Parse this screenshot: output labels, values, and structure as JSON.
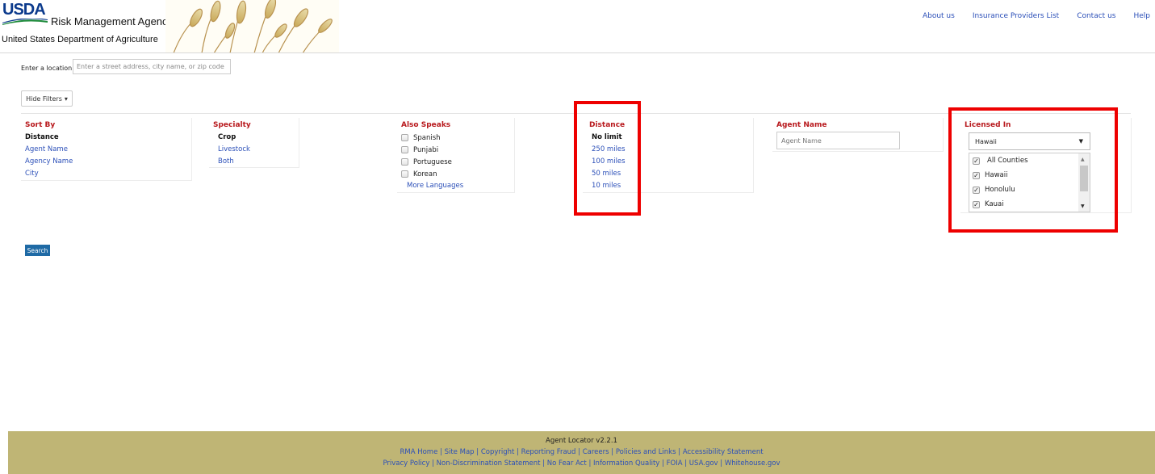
{
  "header": {
    "logo_text": "USDA",
    "agency": "Risk Management Agency",
    "department": "United States Department of Agriculture",
    "nav": [
      "About us",
      "Insurance Providers List",
      "Contact us",
      "Help"
    ]
  },
  "location": {
    "label": "Enter a location",
    "placeholder": "Enter a street address, city name, or zip code",
    "value": ""
  },
  "filters_button": {
    "label": "Hide Filters"
  },
  "sort_by": {
    "title": "Sort By",
    "selected": "Distance",
    "options": [
      "Agent Name",
      "Agency Name",
      "City"
    ]
  },
  "specialty": {
    "title": "Specialty",
    "selected": "Crop",
    "options": [
      "Livestock",
      "Both"
    ]
  },
  "also_speaks": {
    "title": "Also Speaks",
    "languages": [
      "Spanish",
      "Punjabi",
      "Portuguese",
      "Korean"
    ],
    "more": "More Languages"
  },
  "distance": {
    "title": "Distance",
    "selected": "No limit",
    "options": [
      "250 miles",
      "100 miles",
      "50 miles",
      "10 miles"
    ]
  },
  "agent_name": {
    "title": "Agent Name",
    "placeholder": "Agent Name"
  },
  "licensed_in": {
    "title": "Licensed In",
    "selected_state": "Hawaii",
    "counties": [
      "All Counties",
      "Hawaii",
      "Honolulu",
      "Kauai"
    ]
  },
  "search_button": {
    "label": "Search"
  },
  "footer": {
    "version": "Agent Locator v2.2.1",
    "links_row1": [
      "RMA Home",
      "Site Map",
      "Copyright",
      "Reporting Fraud",
      "Careers",
      "Policies and Links",
      "Accessibility Statement"
    ],
    "links_row2": [
      "Privacy Policy",
      "Non-Discrimination Statement",
      "No Fear Act",
      "Information Quality",
      "FOIA",
      "USA.gov",
      "Whitehouse.gov"
    ]
  },
  "colors": {
    "accent_red": "#b8191d",
    "link_blue": "#2b4fb8",
    "search_button": "#1f6aa5",
    "footer_bg": "#bfb575",
    "highlight_box": "#ee0000"
  }
}
